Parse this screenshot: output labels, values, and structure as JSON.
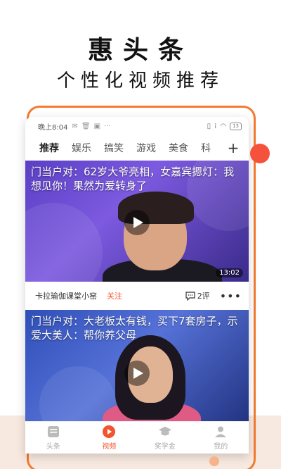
{
  "promo": {
    "title": "惠头条",
    "subtitle": "个性化视频推荐"
  },
  "status_bar": {
    "time": "晚上8:04",
    "battery": "13"
  },
  "tabs": [
    {
      "label": "推荐",
      "active": true
    },
    {
      "label": "娱乐",
      "active": false
    },
    {
      "label": "搞笑",
      "active": false
    },
    {
      "label": "游戏",
      "active": false
    },
    {
      "label": "美食",
      "active": false
    },
    {
      "label": "科",
      "active": false
    }
  ],
  "tab_add_label": "+",
  "videos": [
    {
      "title": "门当户对：62岁大爷亮相，女嘉宾摁灯：我想见你！果然为爱转身了",
      "duration": "13:02",
      "author": "卡拉瑜伽课堂小窑",
      "follow_label": "关注",
      "comments": "2评"
    },
    {
      "title": "门当户对：大老板太有钱，买下7套房子，示爱大美人：帮你养父母",
      "duration": ""
    }
  ],
  "bottom_nav": [
    {
      "label": "头条",
      "icon": "news-icon",
      "active": false
    },
    {
      "label": "视频",
      "icon": "video-play-icon",
      "active": true
    },
    {
      "label": "奖学金",
      "icon": "graduation-cap-icon",
      "active": false
    },
    {
      "label": "我的",
      "icon": "person-icon",
      "active": false
    }
  ],
  "colors": {
    "accent": "#f2542d",
    "frame": "#f47a2f"
  }
}
